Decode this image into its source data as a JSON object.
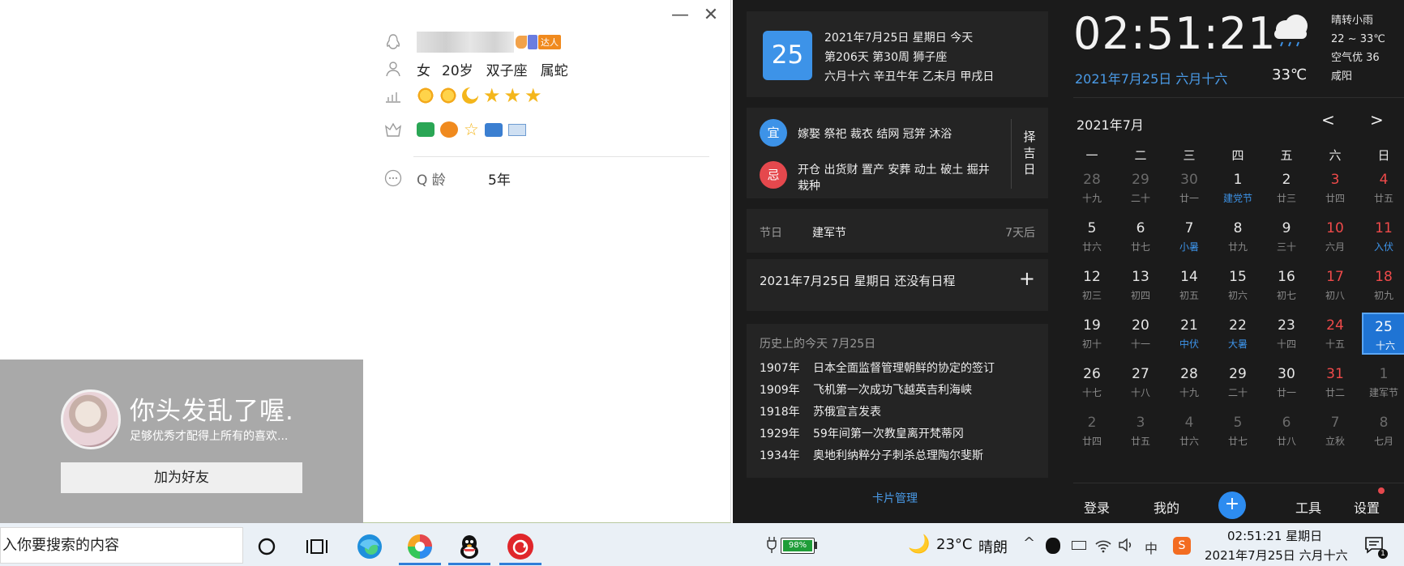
{
  "qq_profile": {
    "minimize_icon": "minimize-icon",
    "close_icon": "close-icon",
    "nickname_badge": "达人",
    "gender": "女",
    "age": "20岁",
    "zodiac": "双子座",
    "chinese_zodiac": "属蛇",
    "qq_age_label": "Q 龄",
    "qq_age_value": "5年",
    "card": {
      "name": "你头发乱了喔.",
      "signature": "足够优秀才配得上所有的喜欢...",
      "add_friend": "加为好友"
    }
  },
  "calendar": {
    "time": "02:51:21",
    "date_lunar": "2021年7月25日 六月十六",
    "weather": {
      "desc": "晴转小雨",
      "range": "22 ~ 33℃",
      "air": "空气优 36",
      "city": "咸阳",
      "temp": "33℃"
    },
    "today": {
      "day": "25",
      "line1": "2021年7月25日 星期日 今天",
      "line2": "第206天 第30周 狮子座",
      "line3": "六月十六 辛丑牛年 乙未月 甲戌日"
    },
    "yi": {
      "badge": "宜",
      "text": "嫁娶 祭祀 裁衣 结网 冠笄 沐浴"
    },
    "ji": {
      "badge": "忌",
      "text1": "开仓 出货财 置产 安葬 动土 破土 掘井",
      "text2": "栽种"
    },
    "zejiri": [
      "择",
      "吉",
      "日"
    ],
    "festival": {
      "label": "节日",
      "name": "建军节",
      "when": "7天后"
    },
    "schedule": {
      "text": "2021年7月25日 星期日 还没有日程",
      "add": "+"
    },
    "history": {
      "title": "历史上的今天 7月25日",
      "items": [
        {
          "year": "1907年",
          "event": "日本全面监督管理朝鲜的协定的签订"
        },
        {
          "year": "1909年",
          "event": "飞机第一次成功飞越英吉利海峡"
        },
        {
          "year": "1918年",
          "event": "苏俄宣言发表"
        },
        {
          "year": "1929年",
          "event": "59年间第一次教皇离开梵蒂冈"
        },
        {
          "year": "1934年",
          "event": "奥地利纳粹分子刺杀总理陶尔斐斯"
        }
      ]
    },
    "card_manage": "卡片管理",
    "month_title": "2021年7月",
    "prev": "<",
    "next": ">",
    "weekdays": [
      "一",
      "二",
      "三",
      "四",
      "五",
      "六",
      "日"
    ],
    "grid": [
      [
        [
          "28",
          "十九"
        ],
        [
          "29",
          "二十"
        ],
        [
          "30",
          "廿一"
        ],
        [
          "1",
          "建党节"
        ],
        [
          "2",
          "廿三"
        ],
        [
          "3",
          "廿四"
        ],
        [
          "4",
          "廿五"
        ]
      ],
      [
        [
          "5",
          "廿六"
        ],
        [
          "6",
          "廿七"
        ],
        [
          "7",
          "小暑"
        ],
        [
          "8",
          "廿九"
        ],
        [
          "9",
          "三十"
        ],
        [
          "10",
          "六月"
        ],
        [
          "11",
          "入伏"
        ]
      ],
      [
        [
          "12",
          "初三"
        ],
        [
          "13",
          "初四"
        ],
        [
          "14",
          "初五"
        ],
        [
          "15",
          "初六"
        ],
        [
          "16",
          "初七"
        ],
        [
          "17",
          "初八"
        ],
        [
          "18",
          "初九"
        ]
      ],
      [
        [
          "19",
          "初十"
        ],
        [
          "20",
          "十一"
        ],
        [
          "21",
          "中伏"
        ],
        [
          "22",
          "大暑"
        ],
        [
          "23",
          "十四"
        ],
        [
          "24",
          "十五"
        ],
        [
          "25",
          "十六"
        ]
      ],
      [
        [
          "26",
          "十七"
        ],
        [
          "27",
          "十八"
        ],
        [
          "28",
          "十九"
        ],
        [
          "29",
          "二十"
        ],
        [
          "30",
          "廿一"
        ],
        [
          "31",
          "廿二"
        ],
        [
          "1",
          "建军节"
        ]
      ],
      [
        [
          "2",
          "廿四"
        ],
        [
          "3",
          "廿五"
        ],
        [
          "4",
          "廿六"
        ],
        [
          "5",
          "廿七"
        ],
        [
          "6",
          "廿八"
        ],
        [
          "7",
          "立秋"
        ],
        [
          "8",
          "七月"
        ]
      ]
    ],
    "bottom": {
      "login": "登录",
      "mine": "我的",
      "add": "+",
      "tools": "工具",
      "settings": "设置"
    }
  },
  "taskbar": {
    "search_placeholder": "入你要搜索的内容",
    "battery": "98%",
    "weather_temp": "23°C",
    "weather_desc": "晴朗",
    "ime": "中",
    "clock_time": "02:51:21 星期日",
    "clock_date": "2021年7月25日 六月十六"
  }
}
